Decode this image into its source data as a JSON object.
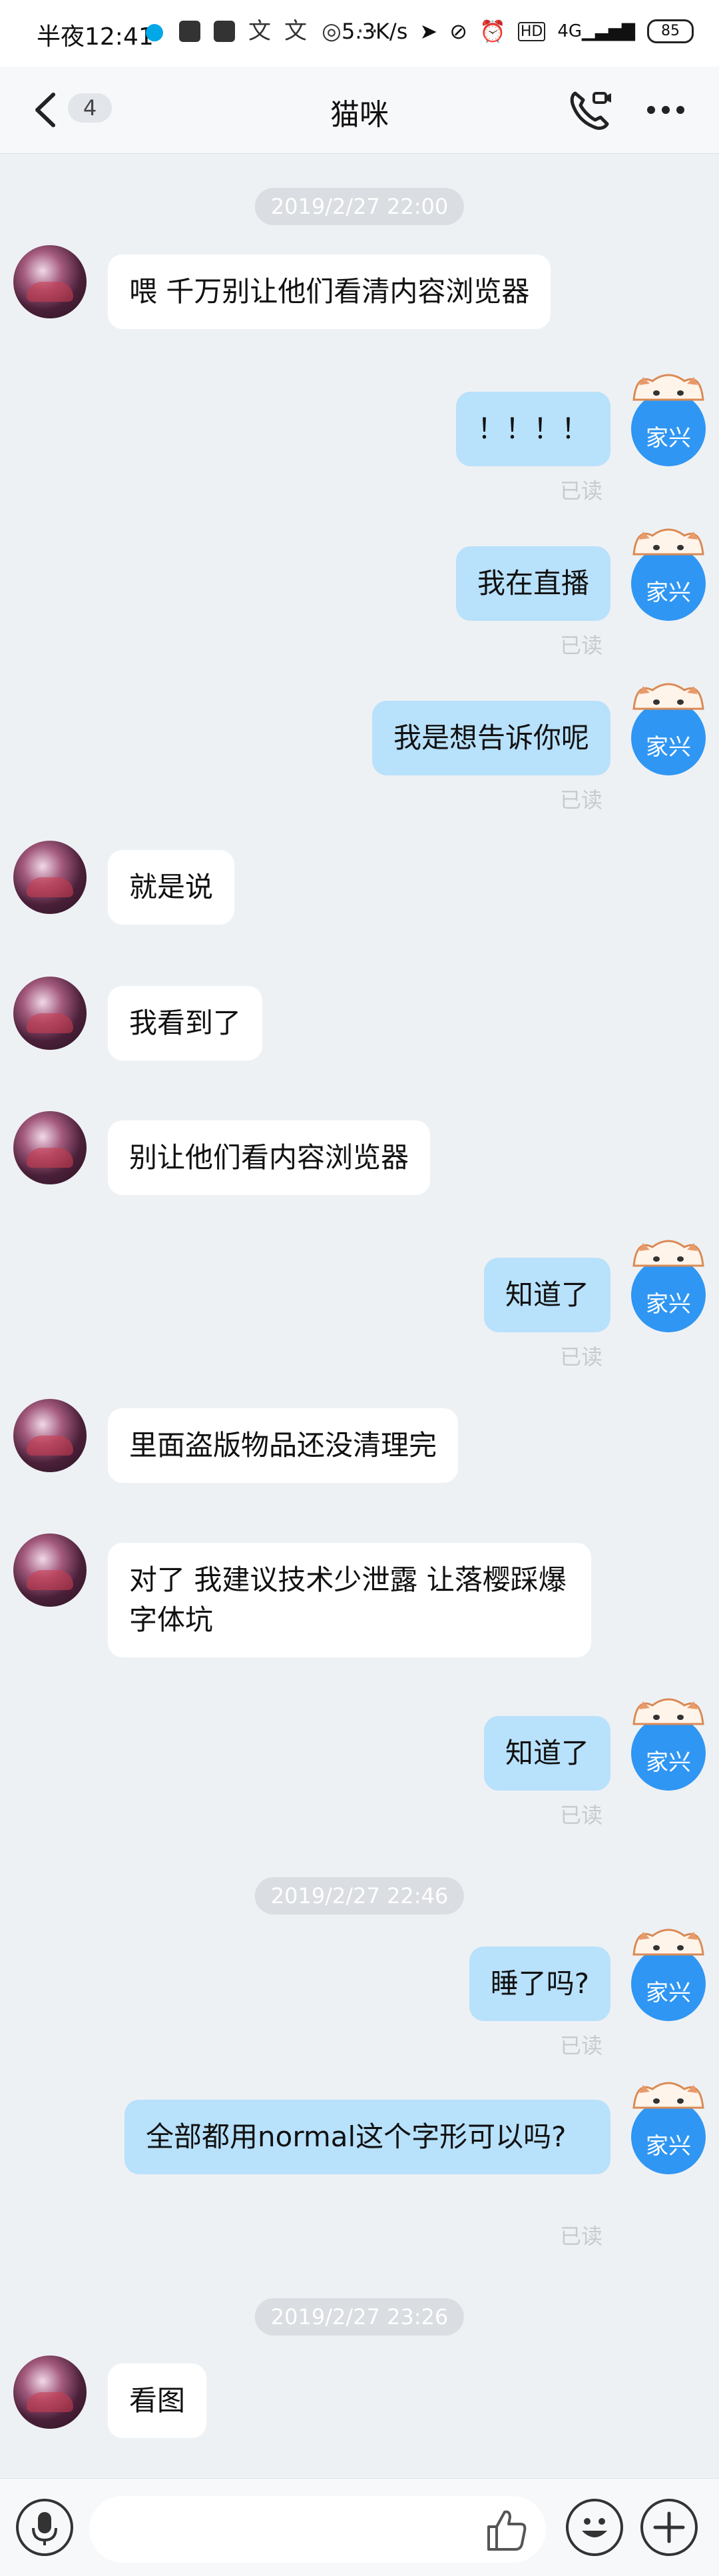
{
  "status_bar": {
    "time": "半夜12:41",
    "net_speed": "5.3K/s",
    "battery": "85",
    "dots": "···"
  },
  "header": {
    "unread_count": "4",
    "title": "猫咪"
  },
  "my_avatar_label": "家兴",
  "read_label": "已读",
  "timestamps": [
    "2019/2/27 22:00",
    "2019/2/27 22:46",
    "2019/2/27 23:26"
  ],
  "messages": [
    {
      "side": "left",
      "text": "喂 千万别让他们看清内容浏览器"
    },
    {
      "side": "right",
      "text": "！！！！",
      "read": true
    },
    {
      "side": "right",
      "text": "我在直播",
      "read": true
    },
    {
      "side": "right",
      "text": "我是想告诉你呢",
      "read": true
    },
    {
      "side": "left",
      "text": "就是说"
    },
    {
      "side": "left",
      "text": "我看到了"
    },
    {
      "side": "left",
      "text": "别让他们看内容浏览器"
    },
    {
      "side": "right",
      "text": "知道了",
      "read": true
    },
    {
      "side": "left",
      "text": "里面盗版物品还没清理完"
    },
    {
      "side": "left",
      "text": "对了 我建议技术少泄露 让落樱踩爆字体坑"
    },
    {
      "side": "right",
      "text": "知道了",
      "read": true
    },
    {
      "side": "right",
      "text": "睡了吗?",
      "read": true
    },
    {
      "side": "right",
      "text": "全部都用normal这个字形可以吗?",
      "read": true
    },
    {
      "side": "left",
      "text": "看图"
    }
  ],
  "input": {
    "value": "",
    "placeholder": ""
  },
  "colors": {
    "background": "#eef1f4",
    "my_bubble": "#b8e1fb",
    "their_bubble": "#ffffff",
    "my_avatar": "#2f96f3"
  }
}
